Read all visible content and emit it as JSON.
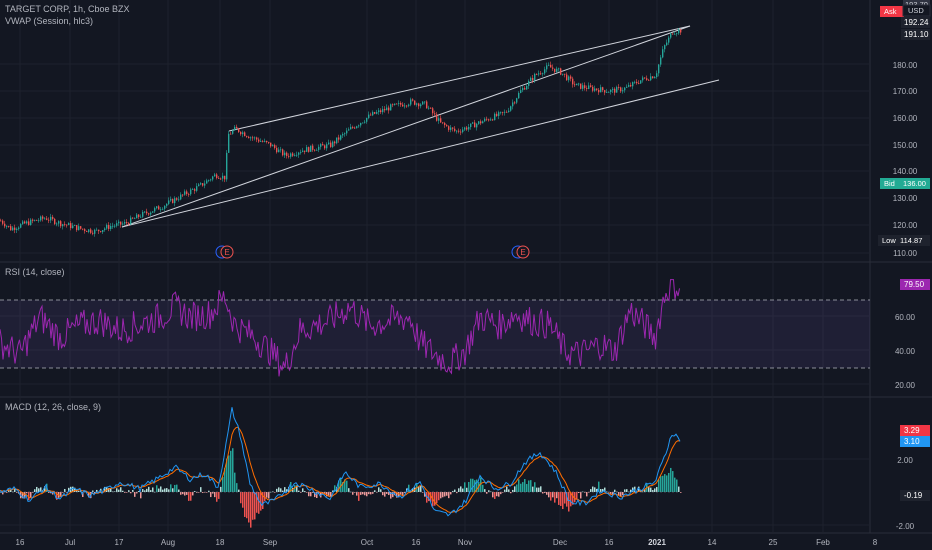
{
  "header": {
    "symbol_line": "TARGET CORP, 1h, Cboe BZX",
    "vwap_line": "VWAP (Session, hlc3)",
    "currency": "USD"
  },
  "rsi_legend": "RSI (14, close)",
  "macd_legend": "MACD (12, 26, close, 9)",
  "x_axis_labels": [
    "16",
    "Jul",
    "17",
    "Aug",
    "18",
    "Sep",
    "Oct",
    "16",
    "Nov",
    "Dec",
    "16",
    "2021",
    "14",
    "25",
    "Feb",
    "8"
  ],
  "earnings_markers": [
    "E",
    "E"
  ],
  "price_panel": {
    "ticks": [
      "200.00",
      "180.00",
      "170.00",
      "160.00",
      "150.00",
      "140.00",
      "130.00",
      "120.00",
      "110.00"
    ],
    "badges": {
      "ask": {
        "label": "Ask",
        "value": "",
        "color": "#f23645"
      },
      "price_top": {
        "value": "193.70",
        "color": "#2f3341"
      },
      "price_current": {
        "value": "192.24",
        "color": "#1e222d"
      },
      "vwap": {
        "value": "191.10",
        "color": "#1e222d"
      },
      "bid": {
        "label": "Bid",
        "value": "136.00",
        "color": "#22ab94"
      },
      "low": {
        "label": "Low",
        "value": "114.87",
        "color": "#1e222d"
      }
    }
  },
  "rsi_panel": {
    "ticks": [
      "60.00",
      "40.00",
      "20.00"
    ],
    "badge": {
      "value": "79.50",
      "color": "#9c27b0"
    }
  },
  "macd_panel": {
    "ticks": [
      "2.00",
      "-2.00"
    ],
    "badges": {
      "macd": {
        "value": "3.29",
        "color": "#f23645"
      },
      "signal": {
        "value": "3.10",
        "color": "#2196f3"
      },
      "hist": {
        "value": "-0.19",
        "color": "#1e222d"
      }
    }
  },
  "colors": {
    "background": "#131722",
    "grid": "#1e222d",
    "up": "#26a69a",
    "down": "#ef5350",
    "rsi": "#9c27b0",
    "macd": "#2196f3",
    "signal": "#ff6d00",
    "channel": "#d1d4dc"
  },
  "chart_data": [
    {
      "type": "candlestick",
      "title": "TARGET CORP, 1h, Cboe BZX",
      "x": [
        "Jun 16",
        "Jul",
        "Jul 17",
        "Aug",
        "Aug 18",
        "Sep",
        "Oct",
        "Oct 16",
        "Nov",
        "Dec",
        "Dec 16",
        "2021",
        "Jan 14"
      ],
      "close": [
        120,
        118,
        120,
        126,
        138,
        148,
        156,
        166,
        154,
        180,
        170,
        173,
        192.24
      ],
      "ylim": [
        110,
        200
      ],
      "channel_lines": [
        {
          "from": [
            "Jul 17",
            121
          ],
          "to": [
            "Jan 11",
            192.5
          ]
        },
        {
          "from": [
            "Jul 17",
            121
          ],
          "to": [
            "Jan 14",
            174
          ]
        }
      ]
    },
    {
      "type": "line",
      "title": "RSI (14, close)",
      "x": [
        "Jun 16",
        "Jul",
        "Jul 17",
        "Aug",
        "Aug 18",
        "Sep",
        "Oct",
        "Oct 16",
        "Nov",
        "Dec",
        "Dec 16",
        "2021",
        "Jan 8"
      ],
      "series": [
        {
          "values": [
            40,
            55,
            52,
            60,
            68,
            45,
            58,
            52,
            35,
            58,
            45,
            50,
            79.5
          ]
        }
      ],
      "bands": [
        30,
        70
      ],
      "ylim": [
        15,
        85
      ]
    },
    {
      "type": "line",
      "title": "MACD (12, 26, close, 9)",
      "x": [
        "Jun 16",
        "Jul",
        "Jul 17",
        "Aug",
        "Aug 18",
        "Sep",
        "Oct",
        "Oct 16",
        "Nov",
        "Dec",
        "Dec 16",
        "2021",
        "Jan 8"
      ],
      "series": [
        {
          "values": [
            0.1,
            -0.2,
            0.3,
            0.8,
            5.0,
            -0.8,
            0.6,
            1.0,
            -1.3,
            2.3,
            -0.7,
            0.1,
            3.29
          ]
        },
        {
          "values": [
            0.0,
            -0.1,
            0.2,
            0.6,
            4.4,
            -0.5,
            0.4,
            0.9,
            -1.0,
            2.0,
            -0.5,
            0.1,
            3.1
          ]
        }
      ],
      "histogram": [
        0.1,
        -0.1,
        0.1,
        0.2,
        0.6,
        -0.3,
        0.2,
        0.1,
        -0.3,
        0.3,
        -0.2,
        0.0,
        -0.19
      ],
      "ylim": [
        -2.5,
        5.5
      ]
    }
  ]
}
